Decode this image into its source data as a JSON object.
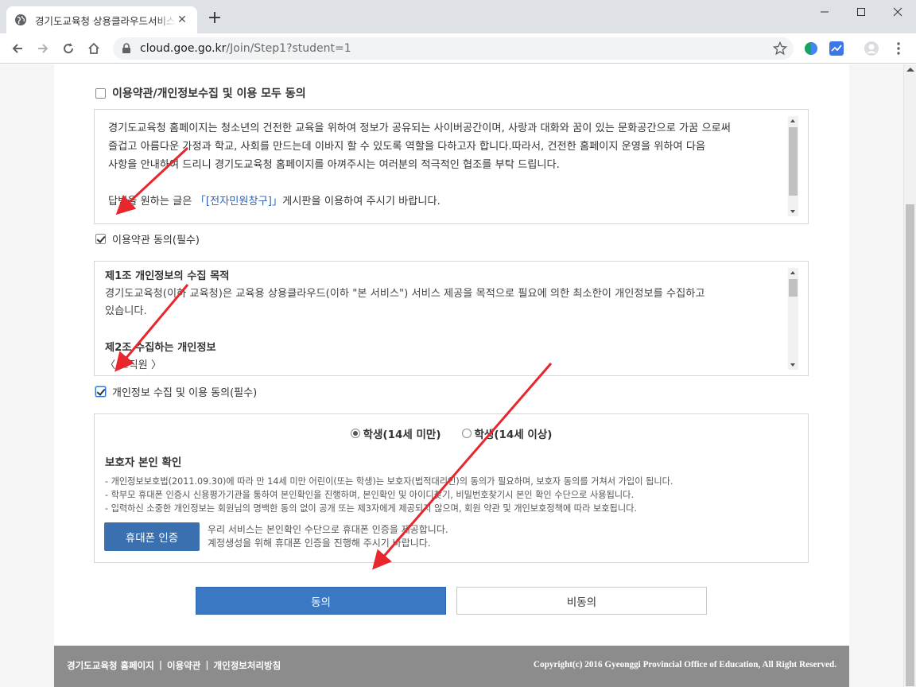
{
  "browser": {
    "tab_title": "경기도교육청 상용클라우드서비스",
    "new_tab_label": "+",
    "url_host": "cloud.goe.go.kr",
    "url_path": "/Join/Step1?student=1"
  },
  "agreement": {
    "all_agree_label": "이용약관/개인정보수집 및 이용 모두 동의",
    "terms": {
      "paragraph1": "경기도교육청 홈페이지는 청소년의 건전한 교육을 위하여 정보가 공유되는 사이버공간이며, 사랑과 대화와 꿈이 있는 문화공간으로 가꿈 으로써",
      "paragraph1b": "즐겁고 아름다운 가정과 학교, 사회를 만드는데 이바지 할 수 있도록 역할을 다하고자 합니다.따라서, 건전한 홈페이지 운영을 위하여 다음",
      "paragraph1c": "사항을 안내하여 드리니 경기도교육청 홈페이지를 아껴주시는 여러분의 적극적인 협조를 부탁 드립니다.",
      "reply_prefix": "답변을 원하는 글은 ",
      "reply_link": "「[전자민원창구]」",
      "reply_suffix": "게시판을 이용하여 주시기 바랍니다."
    },
    "terms_agree_label": "이용약관 동의(필수)",
    "privacy": {
      "art1_title": "제1조 개인정보의 수집 목적",
      "art1_body": "경기도교육청(이하 교육청)은 교육용 상용클라우드(이하 \"본 서비스\") 서비스 제공을 목적으로 필요에 의한 최소한이 개인정보를 수집하고",
      "art1_body2": "있습니다.",
      "art2_title": "제2조 수집하는 개인정보",
      "art2_sub": "〈 교직원 〉"
    },
    "privacy_agree_label": "개인정보 수집 및 이용 동의(필수)"
  },
  "guardian": {
    "radio_under14": "학생(14세 미만)",
    "radio_over14": "학생(14세 이상)",
    "title": "보호자 본인 확인",
    "notes": [
      "- 개인정보보호법(2011.09.30)에 따라 만 14세 미만 어린이(또는 학생)는 보호자(법적대리인)의 동의가 필요하며, 보호자 동의를 거쳐서 가입이 됩니다.",
      "- 학부모 휴대폰 인증시 신용평가기관을 통하여 본인확인을 진행하며, 본인확인 및 아이디찾기, 비밀번호찾기시 본인 확인 수단으로 사용됩니다.",
      "- 입력하신 소중한 개인정보는 회원님의 명백한 동의 없이 공개 또는 제3자에게 제공되지 않으며, 회원 약관 및 개인보호정책에 따라 보호됩니다."
    ],
    "phone_button": "휴대폰 인증",
    "phone_desc1": "우리 서비스는 본인확인 수단으로 휴대폰 인증을 제공합니다.",
    "phone_desc2": "계정생성을 위해 휴대폰 인증을 진행해 주시기 바랍니다."
  },
  "actions": {
    "agree": "동의",
    "disagree": "비동의"
  },
  "footer": {
    "links": [
      "경기도교육청 홈페이지",
      "이용약관",
      "개인정보처리방침"
    ],
    "separator": "|",
    "copyright": "Copyright(c) 2016 Gyeonggi Provincial Office of Education, All Right Reserved."
  },
  "colors": {
    "primary_button": "#3a78c4",
    "annotation_arrow": "#e8262d",
    "footer_bg": "#8c8c8c"
  }
}
